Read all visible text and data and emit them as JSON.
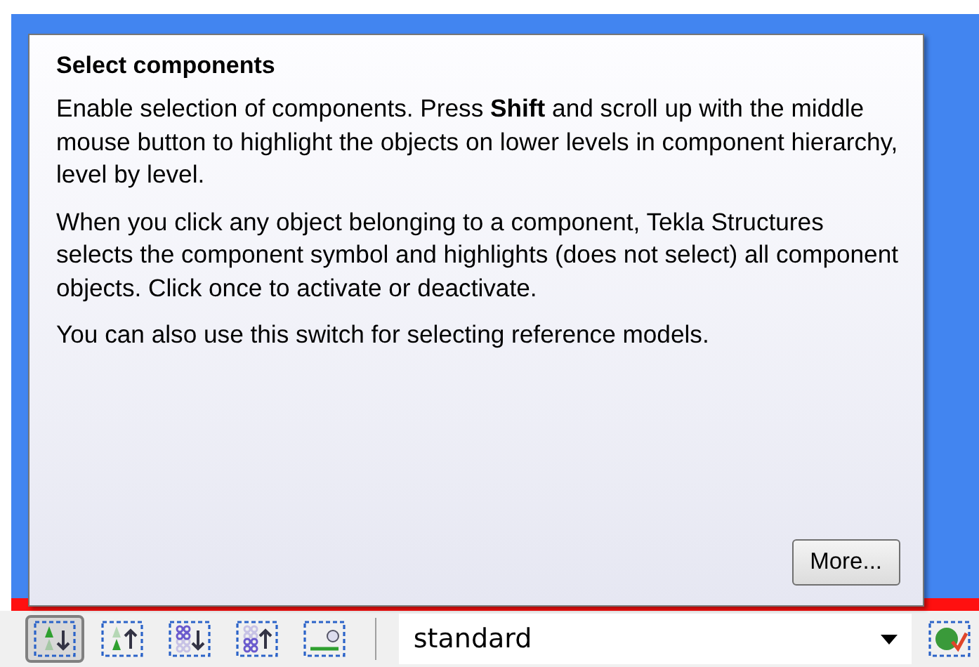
{
  "tooltip": {
    "title": "Select components",
    "paragraphs": [
      "Enable selection of components. Press **Shift** and scroll up with the middle mouse button to highlight the objects on lower levels in component hierarchy, level by level.",
      "When you click any object belonging to a component, Tekla Structures selects the component symbol and highlights (does not select) all component objects. Click once to activate or deactivate.",
      "You can also use this switch for selecting reference models."
    ],
    "button": "More..."
  },
  "toolbar": {
    "switches": [
      {
        "kind": "component-down",
        "selected": true
      },
      {
        "kind": "component-up",
        "selected": false
      },
      {
        "kind": "assembly-down",
        "selected": false
      },
      {
        "kind": "assembly-up",
        "selected": false
      },
      {
        "kind": "plane",
        "selected": false
      }
    ],
    "dropdown": {
      "value": "standard"
    },
    "end_switch": {
      "kind": "reference",
      "selected": false
    }
  }
}
